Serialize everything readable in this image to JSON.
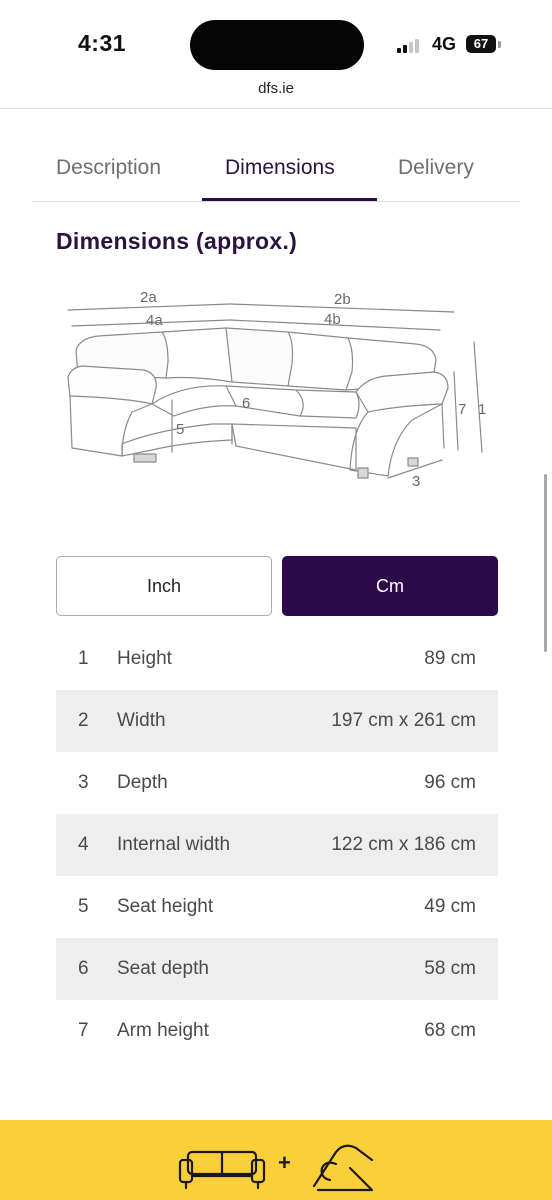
{
  "status_bar": {
    "time": "4:31",
    "network": "4G",
    "battery": "67"
  },
  "browser": {
    "url": "dfs.ie"
  },
  "tabs": [
    {
      "label": "Description"
    },
    {
      "label": "Dimensions",
      "active": true
    },
    {
      "label": "Delivery"
    }
  ],
  "section": {
    "title": "Dimensions (approx.)"
  },
  "diagram": {
    "labels": {
      "l_2a": "2a",
      "l_2b": "2b",
      "l_4a": "4a",
      "l_4b": "4b",
      "l_1": "1",
      "l_7": "7",
      "l_3": "3",
      "l_5": "5",
      "l_6": "6"
    }
  },
  "units": {
    "inch_label": "Inch",
    "cm_label": "Cm",
    "selected": "Cm"
  },
  "dimensions": [
    {
      "num": "1",
      "label": "Height",
      "value": "89 cm"
    },
    {
      "num": "2",
      "label": "Width",
      "value": "197 cm x 261 cm"
    },
    {
      "num": "3",
      "label": "Depth",
      "value": "96 cm"
    },
    {
      "num": "4",
      "label": "Internal width",
      "value": "122 cm x 186 cm"
    },
    {
      "num": "5",
      "label": "Seat height",
      "value": "49 cm"
    },
    {
      "num": "6",
      "label": "Seat depth",
      "value": "58 cm"
    },
    {
      "num": "7",
      "label": "Arm height",
      "value": "68 cm"
    }
  ],
  "promo": {
    "plus": "+"
  },
  "colors": {
    "brand_purple": "#2e0a4a",
    "promo_yellow": "#fbcf3a",
    "row_shade": "#eeeeee"
  }
}
